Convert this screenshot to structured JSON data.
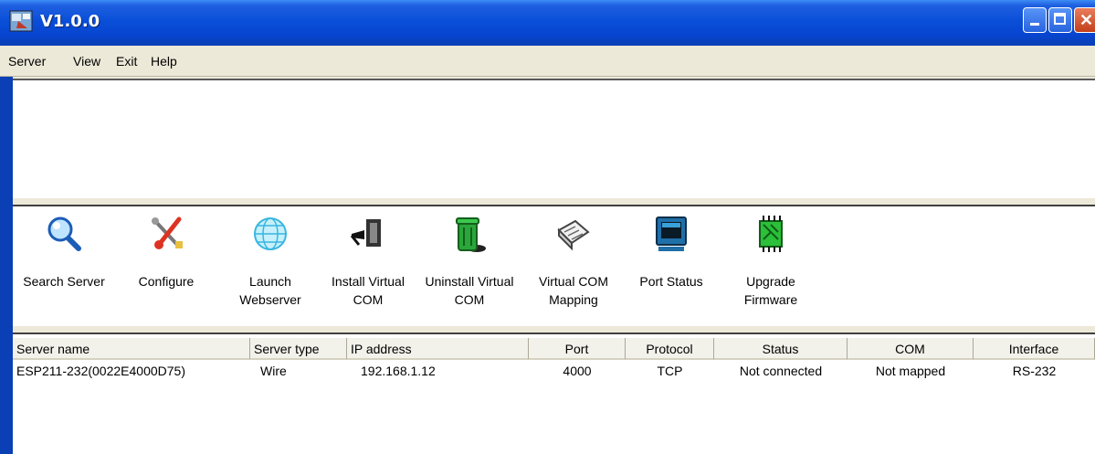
{
  "window": {
    "title": "V1.0.0",
    "icons": {
      "app": "network-app-icon",
      "minimize": "minimize-icon",
      "maximize": "maximize-icon",
      "close": "close-icon"
    },
    "colors": {
      "titlebar": "#0a4fd8",
      "face": "#ece9d8"
    }
  },
  "menu": {
    "items": [
      "Server",
      "View",
      "Exit",
      "Help"
    ]
  },
  "toolbar": {
    "items": [
      {
        "label": "Search Server",
        "icon": "magnifier-icon"
      },
      {
        "label": "Configure",
        "icon": "tools-icon"
      },
      {
        "label": "Launch\nWebserver",
        "icon": "globe-icon"
      },
      {
        "label": "Install Virtual\nCOM",
        "icon": "install-plug-icon"
      },
      {
        "label": "Uninstall Virtual\nCOM",
        "icon": "recycle-bin-icon"
      },
      {
        "label": "Virtual COM\nMapping",
        "icon": "map-scroll-icon"
      },
      {
        "label": "Port Status",
        "icon": "monitor-icon"
      },
      {
        "label": "Upgrade\nFirmware",
        "icon": "chip-icon"
      }
    ]
  },
  "table": {
    "columns": [
      "Server name",
      "Server type",
      "IP address",
      "Port",
      "Protocol",
      "Status",
      "COM",
      "Interface"
    ],
    "rows": [
      [
        "ESP211-232(0022E4000D75)",
        "Wire",
        "192.168.1.12",
        "4000",
        "TCP",
        "Not connected",
        "Not mapped",
        "RS-232"
      ]
    ]
  }
}
